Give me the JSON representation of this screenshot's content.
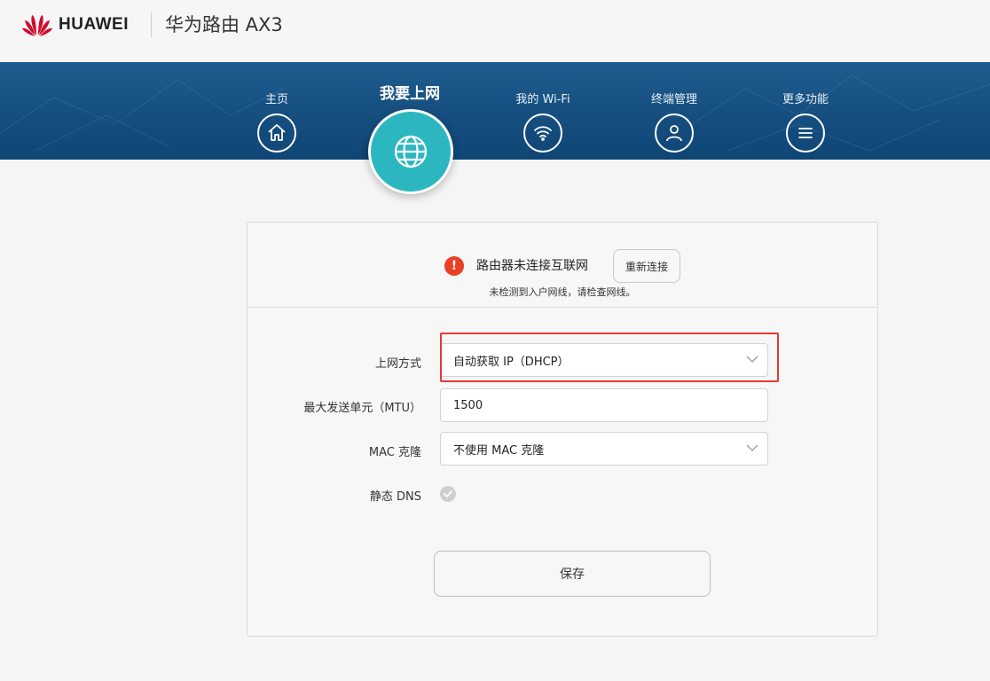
{
  "header": {
    "brand": "HUAWEI",
    "product": "华为路由 AX3",
    "brand_color": "#cf0a2c"
  },
  "nav": {
    "items": [
      {
        "label": "主页",
        "icon": "home-icon"
      },
      {
        "label": "我要上网",
        "icon": "globe-icon",
        "active": true
      },
      {
        "label": "我的 Wi-Fi",
        "icon": "wifi-icon"
      },
      {
        "label": "终端管理",
        "icon": "user-icon"
      },
      {
        "label": "更多功能",
        "icon": "menu-icon"
      }
    ],
    "bar_color": "#154e7f",
    "active_color": "#2cb7c0"
  },
  "status": {
    "icon": "warning-icon",
    "message": "路由器未连接互联网",
    "reconnect_label": "重新连接",
    "detail": "未检测到入户网线，请检查网线。",
    "icon_color": "#e84026"
  },
  "form": {
    "connection_mode": {
      "label": "上网方式",
      "value": "自动获取 IP（DHCP）"
    },
    "mtu": {
      "label": "最大发送单元（MTU）",
      "value": "1500"
    },
    "mac_clone": {
      "label": "MAC 克隆",
      "value": "不使用 MAC 克隆"
    },
    "static_dns": {
      "label": "静态 DNS",
      "checked": false
    },
    "highlight_color": "#e53935"
  },
  "actions": {
    "save_label": "保存"
  }
}
